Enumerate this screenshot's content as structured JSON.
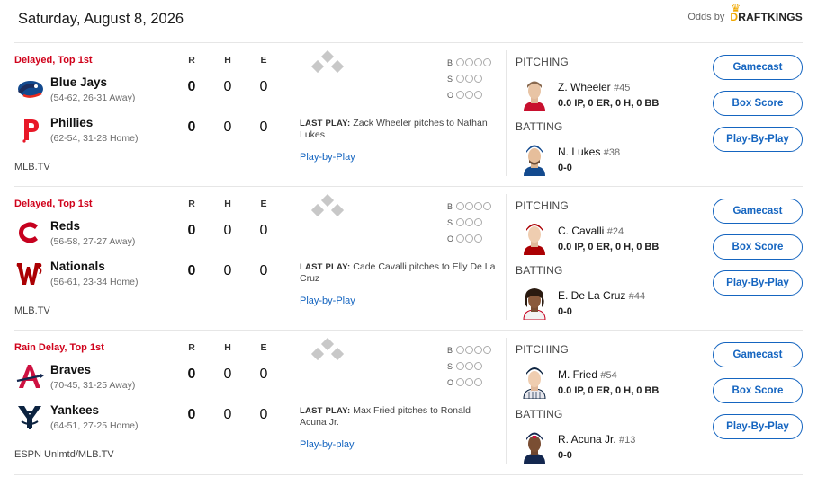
{
  "header": {
    "date": "Saturday, August 8, 2026",
    "odds_label": "Odds by",
    "odds_brand": "DRAFTKINGS",
    "odds_brand_first": "D",
    "odds_brand_rest": "RAFTKINGS"
  },
  "columns": {
    "r": "R",
    "h": "H",
    "e": "E"
  },
  "count_labels": {
    "b": "B",
    "s": "S",
    "o": "O"
  },
  "games": [
    {
      "status": "Delayed, Top 1st",
      "away": {
        "name": "Blue Jays",
        "record": "(54-62, 26-31 Away)",
        "r": "0",
        "h": "0",
        "e": "0",
        "logo": "blue-jays-logo"
      },
      "home": {
        "name": "Phillies",
        "record": "(62-54, 31-28 Home)",
        "r": "0",
        "h": "0",
        "e": "0",
        "logo": "phillies-logo"
      },
      "network": "MLB.TV",
      "last_play_label": "LAST PLAY:",
      "last_play": "Zack Wheeler pitches to Nathan Lukes",
      "pbp_link": "Play-by-Play",
      "pitching_label": "PITCHING",
      "pitcher": {
        "name": "Z. Wheeler",
        "number": "#45",
        "stat": "0.0 IP, 0 ER, 0 H, 0 BB",
        "jersey": "#c8102e"
      },
      "batting_label": "BATTING",
      "batter": {
        "name": "N. Lukes",
        "number": "#38",
        "stat": "0-0",
        "jersey": "#134a8e"
      },
      "buttons": {
        "gamecast": "Gamecast",
        "box_score": "Box Score",
        "pbp": "Play-By-Play"
      }
    },
    {
      "status": "Delayed, Top 1st",
      "away": {
        "name": "Reds",
        "record": "(56-58, 27-27 Away)",
        "r": "0",
        "h": "0",
        "e": "0",
        "logo": "reds-logo"
      },
      "home": {
        "name": "Nationals",
        "record": "(56-61, 23-34 Home)",
        "r": "0",
        "h": "0",
        "e": "0",
        "logo": "nationals-logo"
      },
      "network": "MLB.TV",
      "last_play_label": "LAST PLAY:",
      "last_play": "Cade Cavalli pitches to Elly De La Cruz",
      "pbp_link": "Play-by-Play",
      "pitching_label": "PITCHING",
      "pitcher": {
        "name": "C. Cavalli",
        "number": "#24",
        "stat": "0.0 IP, 0 ER, 0 H, 0 BB",
        "jersey": "#ab0003"
      },
      "batting_label": "BATTING",
      "batter": {
        "name": "E. De La Cruz",
        "number": "#44",
        "stat": "0-0",
        "jersey": "#c6011f"
      },
      "buttons": {
        "gamecast": "Gamecast",
        "box_score": "Box Score",
        "pbp": "Play-By-Play"
      }
    },
    {
      "status": "Rain Delay, Top 1st",
      "away": {
        "name": "Braves",
        "record": "(70-45, 31-25 Away)",
        "r": "0",
        "h": "0",
        "e": "0",
        "logo": "braves-logo"
      },
      "home": {
        "name": "Yankees",
        "record": "(64-51, 27-25 Home)",
        "r": "0",
        "h": "0",
        "e": "0",
        "logo": "yankees-logo"
      },
      "network": "ESPN Unlmtd/MLB.TV",
      "last_play_label": "LAST PLAY:",
      "last_play": "Max Fried pitches to Ronald Acuna Jr.",
      "pbp_link": "Play-by-play",
      "pitching_label": "PITCHING",
      "pitcher": {
        "name": "M. Fried",
        "number": "#54",
        "stat": "0.0 IP, 0 ER, 0 H, 0 BB",
        "jersey": "#0c2340"
      },
      "batting_label": "BATTING",
      "batter": {
        "name": "R. Acuna Jr.",
        "number": "#13",
        "stat": "0-0",
        "jersey": "#13274f"
      },
      "buttons": {
        "gamecast": "Gamecast",
        "box_score": "Box Score",
        "pbp": "Play-By-Play"
      }
    }
  ],
  "colors": {
    "status_red": "#d0021b",
    "link_blue": "#1565c0",
    "base_gray": "#c8c8c8"
  }
}
